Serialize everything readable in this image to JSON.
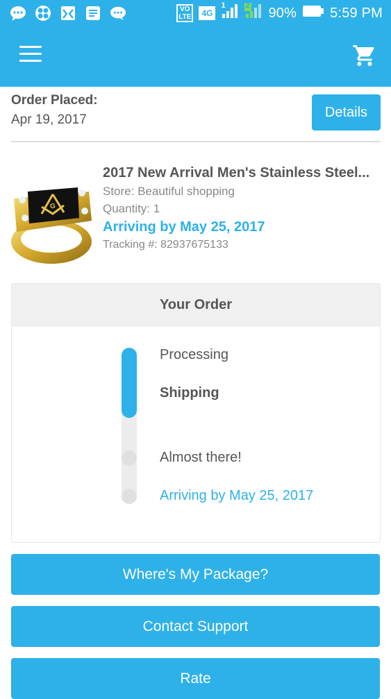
{
  "status_bar": {
    "left_icons": [
      "chat-bubble-icon",
      "pinwheel-icon",
      "gallery-icon",
      "message-icon",
      "speech-bubble-icon"
    ],
    "volte": "VO",
    "lte": "LTE",
    "network": "4G",
    "sim1": "1",
    "sim2": "2",
    "battery": "90%",
    "time": "5:59 PM"
  },
  "app_bar": {
    "menu_icon": "hamburger-menu-icon",
    "cart_icon": "shopping-cart-icon"
  },
  "order": {
    "placed_label": "Order Placed:",
    "placed_date": "Apr 19, 2017",
    "details_label": "Details"
  },
  "product": {
    "image": "gold-masonic-ring-image",
    "title": "2017 New Arrival Men's Stainless Steel...",
    "store": "Store: Beautiful shopping",
    "quantity": "Quantity: 1",
    "arriving": "Arriving by May 25, 2017",
    "tracking": "Tracking #: 82937675133"
  },
  "your_order": {
    "title": "Your Order",
    "progress_fraction": 0.45,
    "steps": [
      {
        "label": "Processing"
      },
      {
        "label": "Shipping"
      },
      {
        "label": "Almost there!"
      },
      {
        "label": "Arriving by May 25, 2017"
      }
    ]
  },
  "actions": {
    "wheres_my_package": "Where's My Package?",
    "contact_support": "Contact Support",
    "rate": "Rate"
  },
  "colors": {
    "accent": "#2eb1e8",
    "text": "#555555",
    "muted": "#888888"
  }
}
